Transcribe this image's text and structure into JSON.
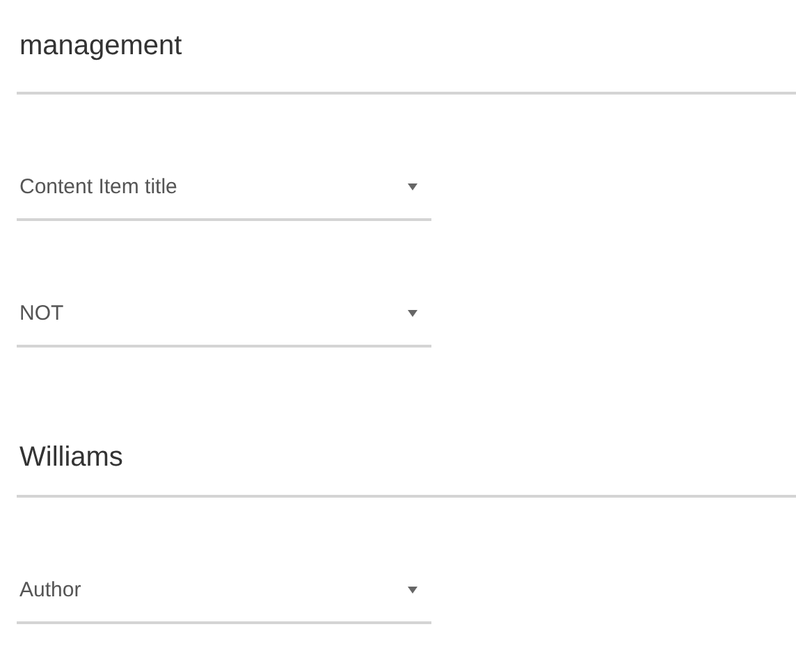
{
  "fields": [
    {
      "kind": "text",
      "value": "management"
    },
    {
      "kind": "select",
      "value": "Content Item title"
    },
    {
      "kind": "select",
      "value": "NOT"
    },
    {
      "kind": "text",
      "value": "Williams"
    },
    {
      "kind": "select",
      "value": "Author"
    }
  ]
}
